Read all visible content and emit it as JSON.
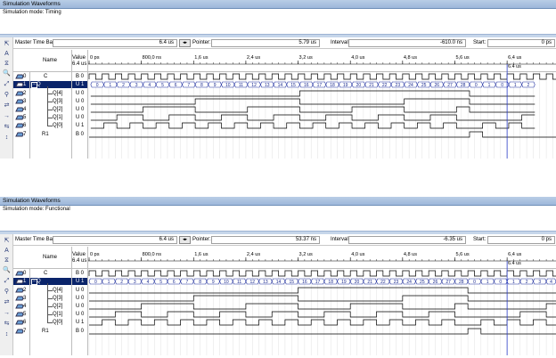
{
  "panels": [
    {
      "window_title": "Simulation Waveforms",
      "mode_label": "Simulation mode: Timing",
      "master_time_bar_label": "Master Time Bar:",
      "master_time_bar_value": "6.4 us",
      "pointer_label": "Pointer:",
      "pointer_value": "5.79 us",
      "interval_label": "Interval:",
      "interval_value": "-610.0 ns",
      "start_label": "Start:",
      "start_value": "0 ps",
      "name_header": "Name",
      "value_header": "Value :",
      "value_header_sub": "6.4 us",
      "marker_label": "6.4 us",
      "time_ticks": [
        "0 ps",
        "800,0 ns",
        "1,6 us",
        "2,4 us",
        "3,2 us",
        "4,0 us",
        "4,8 us",
        "5,6 us",
        "6,4 us"
      ],
      "q_bus_values": [
        "0",
        "1",
        "2",
        "3",
        "4",
        "5",
        "6",
        "7",
        "8",
        "9",
        "10",
        "11",
        "12",
        "13",
        "14",
        "15",
        "16",
        "17",
        "18",
        "19",
        "20",
        "21",
        "22",
        "23",
        "24",
        "25",
        "26",
        "27",
        "28",
        "0",
        "1",
        "0",
        "1",
        "2"
      ],
      "rows": [
        {
          "num": "0",
          "name": "C",
          "value": "B 0"
        },
        {
          "num": "1",
          "name": "Q",
          "value": "U 1"
        },
        {
          "num": "2",
          "name": "Q[4]",
          "value": "U 0"
        },
        {
          "num": "3",
          "name": "Q[3]",
          "value": "U 0"
        },
        {
          "num": "4",
          "name": "Q[2]",
          "value": "U 0"
        },
        {
          "num": "5",
          "name": "Q[1]",
          "value": "U 0"
        },
        {
          "num": "6",
          "name": "Q[0]",
          "value": "U 1"
        },
        {
          "num": "7",
          "name": "R1",
          "value": "B 0"
        }
      ]
    },
    {
      "window_title": "Simulation Waveforms",
      "mode_label": "Simulation mode: Functional",
      "master_time_bar_label": "Master Time Bar:",
      "master_time_bar_value": "6.4 us",
      "pointer_label": "Pointer:",
      "pointer_value": "53.37 ns",
      "interval_label": "Interval:",
      "interval_value": "-6.35 us",
      "start_label": "Start:",
      "start_value": "0 ps",
      "name_header": "Name",
      "value_header": "Value :",
      "value_header_sub": "6.4 us",
      "marker_label": "6.4 us",
      "time_ticks": [
        "0 ps",
        "800,0 ns",
        "1,6 us",
        "2,4 us",
        "3,2 us",
        "4,0 us",
        "4,8 us",
        "5,6 us",
        "6,4 us",
        "7."
      ],
      "q_bus_values": [
        "0",
        "1",
        "2",
        "3",
        "4",
        "5",
        "6",
        "7",
        "8",
        "9",
        "10",
        "11",
        "12",
        "13",
        "14",
        "15",
        "16",
        "17",
        "18",
        "19",
        "20",
        "21",
        "22",
        "23",
        "24",
        "25",
        "26",
        "27",
        "28",
        "0",
        "1",
        "0",
        "1",
        "2",
        "3",
        "4"
      ],
      "rows": [
        {
          "num": "0",
          "name": "C",
          "value": "B 0"
        },
        {
          "num": "1",
          "name": "Q",
          "value": "U 1"
        },
        {
          "num": "2",
          "name": "Q[4]",
          "value": "U 0"
        },
        {
          "num": "3",
          "name": "Q[3]",
          "value": "U 0"
        },
        {
          "num": "4",
          "name": "Q[2]",
          "value": "U 0"
        },
        {
          "num": "5",
          "name": "Q[1]",
          "value": "U 0"
        },
        {
          "num": "6",
          "name": "Q[0]",
          "value": "U 1"
        },
        {
          "num": "7",
          "name": "R1",
          "value": "B 0"
        }
      ]
    }
  ],
  "tool_icons": [
    "pointer-icon",
    "text-tool-icon",
    "waveform-edit-icon",
    "zoom-icon",
    "fullscreen-icon",
    "find-icon",
    "replace-icon",
    "insert-icon",
    "overwrite-icon",
    "sort-icon"
  ],
  "colors": {
    "titlebar": "#9db7da",
    "selected_row": "#0a246a",
    "marker_line": "#2a3cc8",
    "bus_value_text": "#1a2a90"
  }
}
